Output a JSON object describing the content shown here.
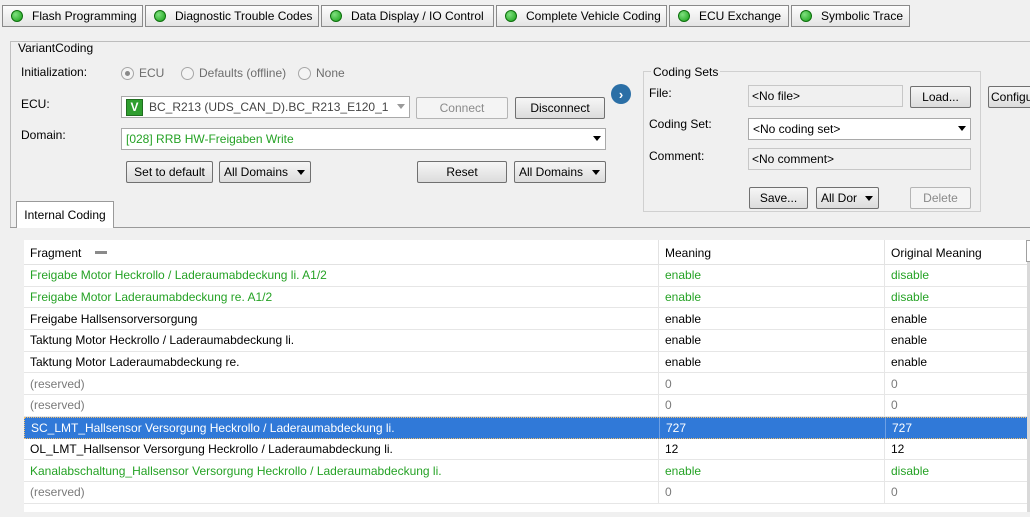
{
  "tabs": [
    {
      "label": "Flash Programming"
    },
    {
      "label": "Diagnostic Trouble Codes"
    },
    {
      "label": "Data Display / IO Control"
    },
    {
      "label": "Complete Vehicle Coding"
    },
    {
      "label": "ECU Exchange"
    },
    {
      "label": "Symbolic Trace"
    }
  ],
  "variant": {
    "group_title": "VariantCoding",
    "init_label": "Initialization:",
    "init_options": [
      "ECU",
      "Defaults (offline)",
      "None"
    ],
    "init_selected": "ECU",
    "ecu_label": "ECU:",
    "ecu_badge": "V",
    "ecu_value": "BC_R213 (UDS_CAN_D).BC_R213_E120_1",
    "connect_label": "Connect",
    "disconnect_label": "Disconnect",
    "domain_label": "Domain:",
    "domain_value": "[028] RRB HW-Freigaben Write",
    "set_default_label": "Set to default",
    "all_domains_left": "All Domains",
    "reset_label": "Reset",
    "all_domains_right": "All Domains"
  },
  "coding_sets": {
    "title": "Coding Sets",
    "file_label": "File:",
    "file_value": "<No file>",
    "load_label": "Load...",
    "configure_label": "Configu",
    "coding_set_label": "Coding Set:",
    "coding_set_value": "<No coding set>",
    "comment_label": "Comment:",
    "comment_value": "<No comment>",
    "save_label": "Save...",
    "all_dor_label": "All Dor",
    "delete_label": "Delete"
  },
  "inner_tab": {
    "label": "Internal Coding"
  },
  "table": {
    "columns": [
      "Fragment",
      "Meaning",
      "Original Meaning"
    ],
    "rows": [
      {
        "fragment": "Freigabe Motor Heckrollo / Laderaumabdeckung li. A1/2",
        "meaning": "enable",
        "original": "disable",
        "style": "green"
      },
      {
        "fragment": "Freigabe Motor Laderaumabdeckung re. A1/2",
        "meaning": "enable",
        "original": "disable",
        "style": "green"
      },
      {
        "fragment": "Freigabe Hallsensorversorgung",
        "meaning": "enable",
        "original": "enable",
        "style": "normal"
      },
      {
        "fragment": "Taktung Motor Heckrollo / Laderaumabdeckung li.",
        "meaning": "enable",
        "original": "enable",
        "style": "normal"
      },
      {
        "fragment": "Taktung Motor Laderaumabdeckung re.",
        "meaning": "enable",
        "original": "enable",
        "style": "normal"
      },
      {
        "fragment": "(reserved)",
        "meaning": "0",
        "original": "0",
        "style": "reserved"
      },
      {
        "fragment": "(reserved)",
        "meaning": "0",
        "original": "0",
        "style": "reserved"
      },
      {
        "fragment": "SC_LMT_Hallsensor Versorgung Heckrollo / Laderaumabdeckung li.",
        "meaning": "727",
        "original": "727",
        "style": "selected"
      },
      {
        "fragment": "OL_LMT_Hallsensor Versorgung Heckrollo / Laderaumabdeckung li.",
        "meaning": "12",
        "original": "12",
        "style": "normal"
      },
      {
        "fragment": "Kanalabschaltung_Hallsensor Versorgung Heckrollo / Laderaumabdeckung li.",
        "meaning": "enable",
        "original": "disable",
        "style": "green"
      },
      {
        "fragment": "(reserved)",
        "meaning": "0",
        "original": "0",
        "style": "reserved"
      }
    ]
  },
  "colors": {
    "status_green": "#15a015",
    "changed_text": "#25a225",
    "selection": "#3079d8"
  }
}
